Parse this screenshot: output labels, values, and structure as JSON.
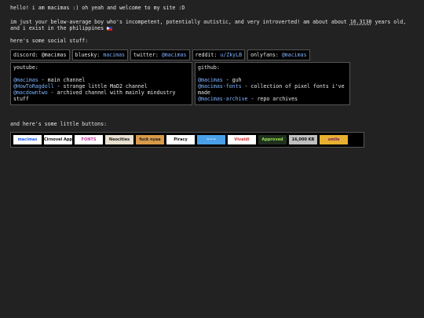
{
  "intro": "hello! i am macimas :) oh yeah and welcome to my site :D",
  "about": {
    "before": "im just your below-average boy who's incompetent, potentially autistic, and very introverted! am about about ",
    "age": "16.3138",
    "after": " years old, and i exist in the philippines"
  },
  "social": {
    "heading": "here's some social stuff:",
    "links": [
      {
        "label": "discord: ",
        "handle": "@macimas",
        "link": false
      },
      {
        "label": "bluesky: ",
        "handle": "macimas",
        "link": true
      },
      {
        "label": "twitter: ",
        "handle": "@macimas",
        "link": true
      },
      {
        "label": "reddit: ",
        "handle": "u/ZkyLB",
        "link": true
      },
      {
        "label": "onlyfans: ",
        "handle": "@macimas",
        "link": true
      }
    ]
  },
  "youtube": {
    "title": "youtube:",
    "items": [
      {
        "handle": "@macimas",
        "desc": " - main channel"
      },
      {
        "handle": "@HowToRagdoll",
        "desc": " - strange little MaD2 channel"
      },
      {
        "handle": "@macdowntwo",
        "desc": " - archived channel with mainly mindustry stuff"
      }
    ]
  },
  "github": {
    "title": "github:",
    "items": [
      {
        "handle": "@macimas",
        "desc": " - guh"
      },
      {
        "handle": "@macimas-fonts",
        "desc": " - collection of pixel fonts i've made"
      },
      {
        "handle": "@macimas-archive",
        "desc": " - repo archives"
      }
    ]
  },
  "buttons": {
    "heading": "and here's some little buttons:",
    "items": [
      {
        "name": "macimas-button",
        "text": "macimas",
        "bg": "#ffffff",
        "fg": "#1a5cff"
      },
      {
        "name": "cirno-approved-button",
        "text": "Cirnovel Approved",
        "bg": "#ffffff",
        "fg": "#111111"
      },
      {
        "name": "fonts-button",
        "text": "FONTS",
        "bg": "#ffffff",
        "fg": "#c040a0"
      },
      {
        "name": "neocities-button",
        "text": "Neocities",
        "bg": "#e8e0d0",
        "fg": "#222222"
      },
      {
        "name": "cat-button",
        "text": "fuck nyaa",
        "bg": "#d89a4a",
        "fg": "#222222"
      },
      {
        "name": "piracy-button",
        "text": "Piracy",
        "bg": "#ffffff",
        "fg": "#111111"
      },
      {
        "name": "blue-button",
        "text": "~~~",
        "bg": "#4aa0e8",
        "fg": "#ffffff"
      },
      {
        "name": "vivaldi-button",
        "text": "Vivaldi",
        "bg": "#ffffff",
        "fg": "#d43030"
      },
      {
        "name": "approved-button",
        "text": "Approved",
        "bg": "#203020",
        "fg": "#9be050"
      },
      {
        "name": "web-button",
        "text": "16,000 KB",
        "bg": "#c0c0c0",
        "fg": "#111111"
      },
      {
        "name": "pride-button",
        "text": "smile",
        "bg": "#e8b030",
        "fg": "#7a2060"
      }
    ]
  }
}
